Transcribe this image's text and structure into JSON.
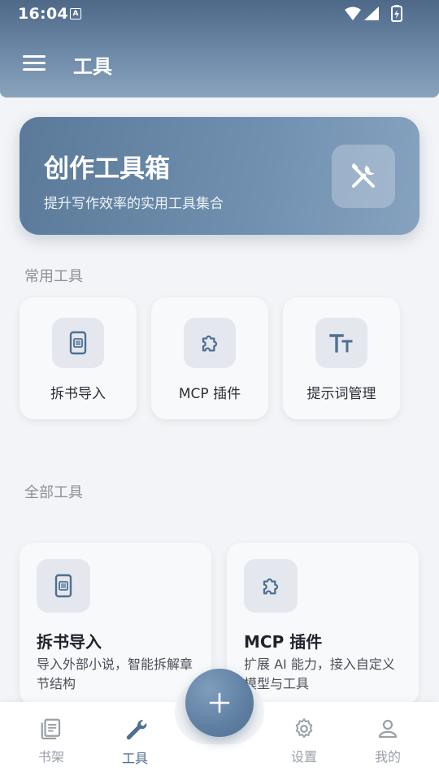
{
  "status_bar": {
    "time": "16:04",
    "badge": "A"
  },
  "header": {
    "title": "工具"
  },
  "hero": {
    "title": "创作工具箱",
    "subtitle": "提升写作效率的实用工具集合",
    "icon": "tools-icon"
  },
  "sections": {
    "common": "常用工具",
    "all": "全部工具"
  },
  "quick_tools": [
    {
      "label": "拆书导入",
      "icon": "book-import-icon"
    },
    {
      "label": "MCP 插件",
      "icon": "puzzle-icon"
    },
    {
      "label": "提示词管理",
      "icon": "text-size-icon"
    }
  ],
  "all_tools": [
    {
      "title": "拆书导入",
      "desc": "导入外部小说，智能拆解章节结构",
      "icon": "book-import-icon"
    },
    {
      "title": "MCP 插件",
      "desc": "扩展 AI 能力，接入自定义模型与工具",
      "icon": "puzzle-icon"
    }
  ],
  "bottom_nav": [
    {
      "label": "书架",
      "icon": "bookshelf-icon"
    },
    {
      "label": "工具",
      "icon": "wrench-icon",
      "active": true
    },
    {
      "label": "设置",
      "icon": "gear-icon"
    },
    {
      "label": "我的",
      "icon": "person-icon"
    }
  ],
  "fab": {
    "icon": "plus-icon"
  },
  "colors": {
    "primary": "#5f7fa2",
    "active_nav": "#4c6e92",
    "inactive_nav": "#9aa0a8"
  }
}
